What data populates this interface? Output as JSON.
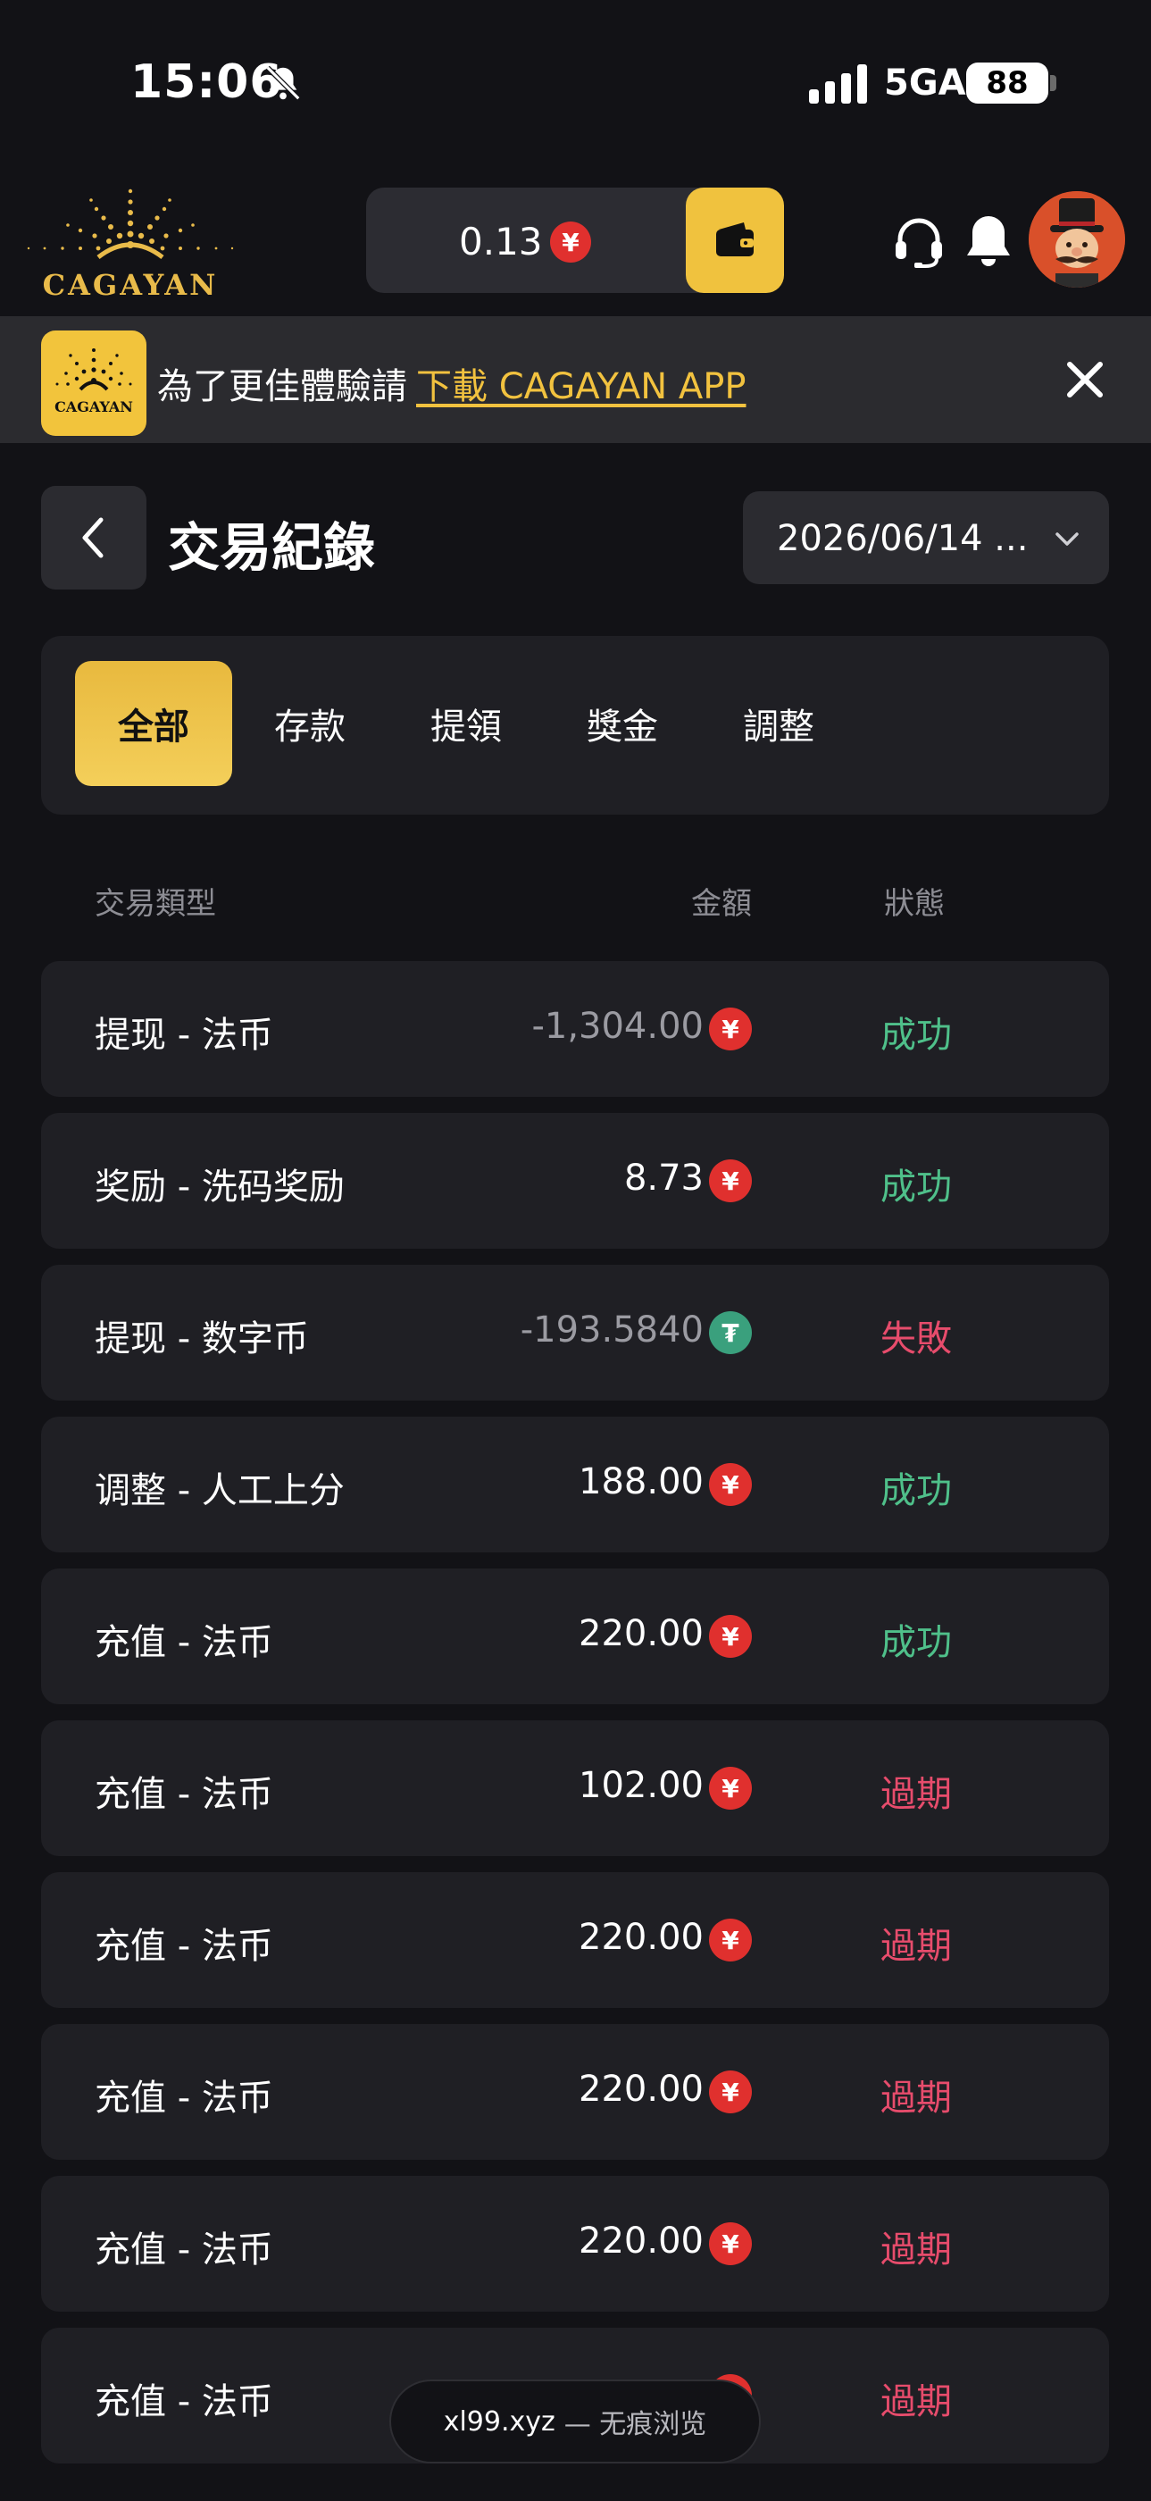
{
  "status_bar": {
    "time": "15:06",
    "network": "5GA",
    "battery": "88"
  },
  "header": {
    "logo_text": "CAGAYAN",
    "balance": "0.13",
    "currency_symbol": "¥"
  },
  "banner": {
    "logo_text": "CAGAYAN",
    "text": "為了更佳體驗請",
    "link": "下載 CAGAYAN APP"
  },
  "page": {
    "title": "交易紀錄",
    "date_filter": "2026/06/14 ..."
  },
  "tabs": [
    {
      "label": "全部",
      "active": true
    },
    {
      "label": "存款",
      "active": false
    },
    {
      "label": "提領",
      "active": false
    },
    {
      "label": "獎金",
      "active": false
    },
    {
      "label": "調整",
      "active": false
    }
  ],
  "table": {
    "headers": {
      "type": "交易類型",
      "amount": "金額",
      "status": "狀態"
    },
    "rows": [
      {
        "type": "提现 - 法币",
        "amount": "-1,304.00",
        "currency": "¥",
        "status": "成功"
      },
      {
        "type": "奖励 - 洗码奖励",
        "amount": "8.73",
        "currency": "¥",
        "status": "成功"
      },
      {
        "type": "提现 - 数字币",
        "amount": "-193.5840",
        "currency": "₮",
        "status": "失敗"
      },
      {
        "type": "调整 - 人工上分",
        "amount": "188.00",
        "currency": "¥",
        "status": "成功"
      },
      {
        "type": "充值 - 法币",
        "amount": "220.00",
        "currency": "¥",
        "status": "成功"
      },
      {
        "type": "充值 - 法币",
        "amount": "102.00",
        "currency": "¥",
        "status": "過期"
      },
      {
        "type": "充值 - 法币",
        "amount": "220.00",
        "currency": "¥",
        "status": "過期"
      },
      {
        "type": "充值 - 法币",
        "amount": "220.00",
        "currency": "¥",
        "status": "過期"
      },
      {
        "type": "充值 - 法币",
        "amount": "220.00",
        "currency": "¥",
        "status": "過期"
      },
      {
        "type": "充值 - 法币",
        "amount": "",
        "currency": "¥",
        "status": "過期"
      }
    ]
  },
  "browser_pill": {
    "domain": "xl99.xyz",
    "note": "— 无痕浏览"
  },
  "colors": {
    "background": "#121216",
    "card": "#1f1f24",
    "accent_gold": "#f0c23e",
    "success": "#4fc08a",
    "fail": "#e74c6c",
    "yuan_red": "#e0302e",
    "usdt_green": "#3aa07d"
  }
}
